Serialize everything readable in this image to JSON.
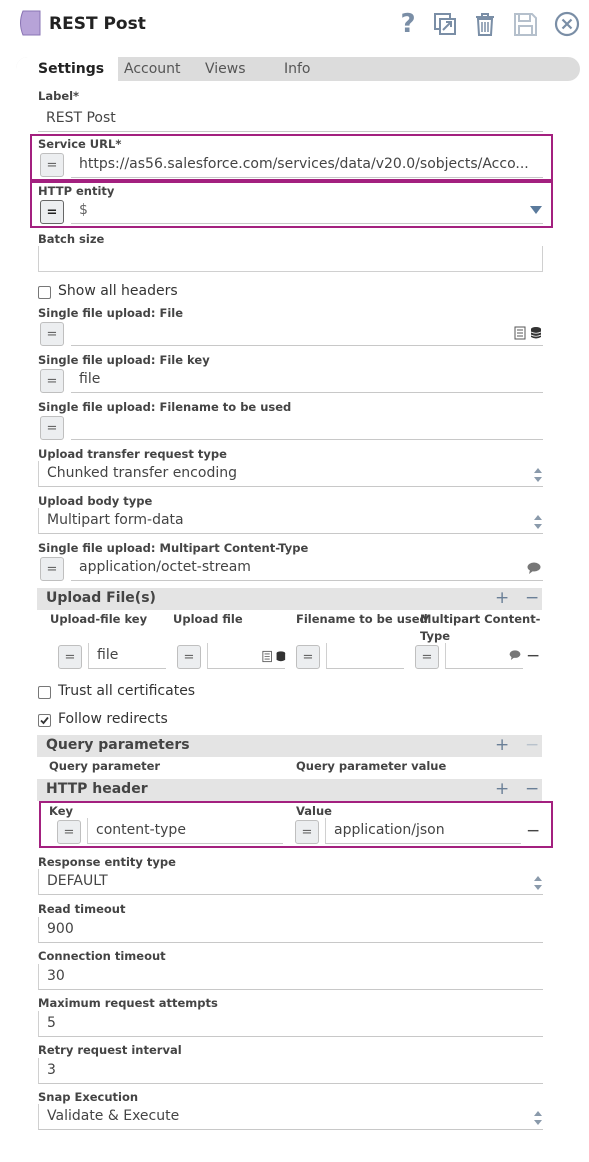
{
  "header": {
    "title": "REST Post",
    "help_glyph": "?",
    "accent_color": "#b7a3d8",
    "icons": [
      "help-icon",
      "export-icon",
      "delete-icon",
      "save-icon",
      "close-icon"
    ]
  },
  "tabs": [
    {
      "label": "Settings",
      "active": true
    },
    {
      "label": "Account",
      "active": false
    },
    {
      "label": "Views",
      "active": false
    },
    {
      "label": "Info",
      "active": false
    }
  ],
  "eq_glyph": "=",
  "form": {
    "label": {
      "label": "Label*",
      "value": "REST Post"
    },
    "service_url": {
      "label": "Service URL*",
      "value": "https://as56.salesforce.com/services/data/v20.0/sobjects/Acco..."
    },
    "http_entity": {
      "label": "HTTP entity",
      "value": "$"
    },
    "batch_size": {
      "label": "Batch size",
      "value": ""
    },
    "show_all_headers": {
      "label": "Show all headers",
      "checked": false
    },
    "single_file": {
      "label": "Single file upload: File",
      "value": ""
    },
    "single_file_key": {
      "label": "Single file upload: File key",
      "value": "file"
    },
    "single_filename": {
      "label": "Single file upload: Filename to be used",
      "value": ""
    },
    "upload_transfer": {
      "label": "Upload transfer request type",
      "value": "Chunked transfer encoding"
    },
    "upload_body": {
      "label": "Upload body type",
      "value": "Multipart form-data"
    },
    "multipart_ct": {
      "label": "Single file upload: Multipart Content-Type",
      "value": "application/octet-stream"
    },
    "upload_files": {
      "title": "Upload File(s)",
      "plus": "+",
      "minus": "−",
      "columns": [
        "Upload-file key",
        "Upload file",
        "Filename to be used",
        "Multipart Content-",
        "Type"
      ],
      "row": {
        "key": "file",
        "file": "",
        "filename": "",
        "content_type": ""
      }
    },
    "trust_all": {
      "label": "Trust all certificates",
      "checked": false
    },
    "follow_redirects": {
      "label": "Follow redirects",
      "checked": true
    },
    "query_params": {
      "title": "Query parameters",
      "plus": "+",
      "minus": "−",
      "columns": [
        "Query parameter",
        "Query parameter value"
      ]
    },
    "http_header": {
      "title": "HTTP header",
      "plus": "+",
      "minus": "−",
      "columns": [
        "Key",
        "Value"
      ],
      "row": {
        "key": "content-type",
        "value": "application/json"
      }
    },
    "response_entity": {
      "label": "Response entity type",
      "value": "DEFAULT"
    },
    "read_timeout": {
      "label": "Read timeout",
      "value": "900"
    },
    "conn_timeout": {
      "label": "Connection timeout",
      "value": "30"
    },
    "max_attempts": {
      "label": "Maximum request attempts",
      "value": "5"
    },
    "retry_interval": {
      "label": "Retry request interval",
      "value": "3"
    },
    "snap_exec": {
      "label": "Snap Execution",
      "value": "Validate & Execute"
    }
  }
}
